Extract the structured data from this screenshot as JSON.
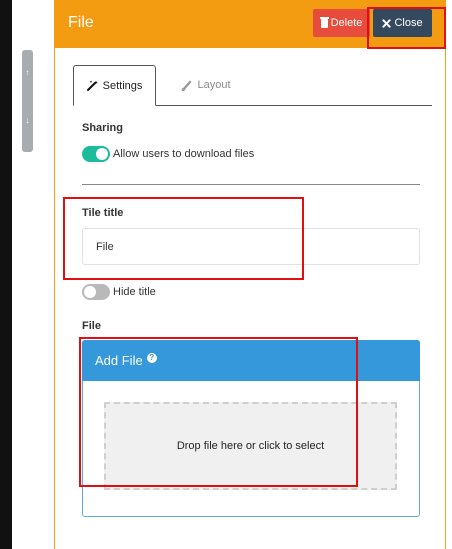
{
  "header": {
    "title": "File",
    "delete_label": "Delete",
    "close_label": "Close"
  },
  "scroll": {
    "up_glyph": "↑",
    "down_glyph": "↓"
  },
  "tabs": [
    {
      "label": "Settings",
      "icon": "magic-wand-icon",
      "active": true
    },
    {
      "label": "Layout",
      "icon": "brush-icon",
      "active": false
    }
  ],
  "sharing": {
    "label": "Sharing",
    "toggle_text": "Allow users to download files",
    "enabled": true
  },
  "tile_title": {
    "label": "Tile title",
    "value": "File"
  },
  "hide_title": {
    "toggle_text": "Hide title",
    "enabled": false
  },
  "file": {
    "label": "File",
    "panel_title": "Add File",
    "help_glyph": "?",
    "dropzone_text": "Drop file here or click to select"
  },
  "colors": {
    "header": "#f39c12",
    "delete": "#e74c3c",
    "close": "#34495e",
    "toggle_on": "#1abc9c",
    "file_header": "#3498db",
    "highlight": "#e01010"
  }
}
